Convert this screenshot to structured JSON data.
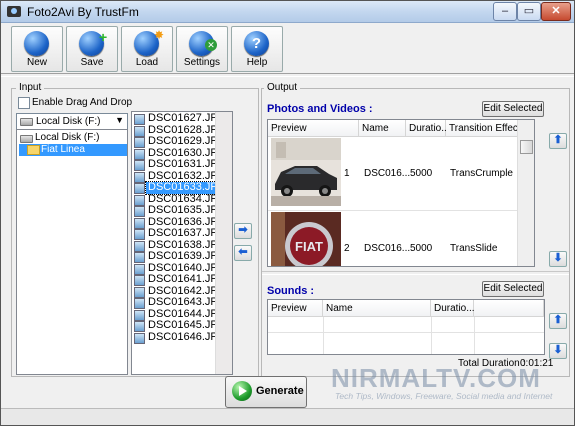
{
  "window": {
    "title": "Foto2Avi By TrustFm",
    "controls": {
      "minimize": "–",
      "maximize": "▭",
      "close": "✕"
    }
  },
  "toolbar": {
    "new_label": "New",
    "save_label": "Save",
    "load_label": "Load",
    "settings_label": "Settings",
    "help_label": "Help",
    "help_glyph": "?"
  },
  "input": {
    "group_label": "Input",
    "drag_drop_label": "Enable Drag And Drop",
    "drag_drop_checked": false,
    "drive_selected": "Local Disk (F:)",
    "tree": [
      "Local Disk (F:)",
      "Fiat Linea"
    ],
    "tree_selected": "Fiat Linea",
    "files": [
      "DSC01627.JPG",
      "DSC01628.JPG",
      "DSC01629.JPG",
      "DSC01630.JPG",
      "DSC01631.JPG",
      "DSC01632.JPG",
      "DSC01633.JPG",
      "DSC01634.JPG",
      "DSC01635.JPG",
      "DSC01636.JPG",
      "DSC01637.JPG",
      "DSC01638.JPG",
      "DSC01639.JPG",
      "DSC01640.JPG",
      "DSC01641.JPG",
      "DSC01642.JPG",
      "DSC01643.JPG",
      "DSC01644.JPG",
      "DSC01645.JPG",
      "DSC01646.JPG"
    ],
    "selected_file": "DSC01633.JPG"
  },
  "output": {
    "group_label": "Output",
    "photos_title": "Photos and Videos :",
    "edit_selected_label": "Edit Selected",
    "photo_columns": [
      "Preview",
      "Name",
      "Duratio...",
      "Transition Effect"
    ],
    "photo_rows": [
      {
        "index": "1",
        "name": "DSC016...",
        "duration": "5000",
        "transition": "TransCrumple"
      },
      {
        "index": "2",
        "name": "DSC016...",
        "duration": "5000",
        "transition": "TransSlide"
      }
    ],
    "sounds_title": "Sounds :",
    "sounds_edit_label": "Edit Selected",
    "sound_columns": [
      "Preview",
      "Name",
      "Duratio..."
    ],
    "total_duration_label": "Total Duration :",
    "total_duration_value": "0:01:21"
  },
  "generate_label": "Generate",
  "watermark": {
    "site": "NIRMALTV.COM",
    "tagline": "Tech Tips, Windows, Freeware, Social media and Internet"
  },
  "colors": {
    "accent": "#0000aa",
    "selection": "#3399ff"
  }
}
